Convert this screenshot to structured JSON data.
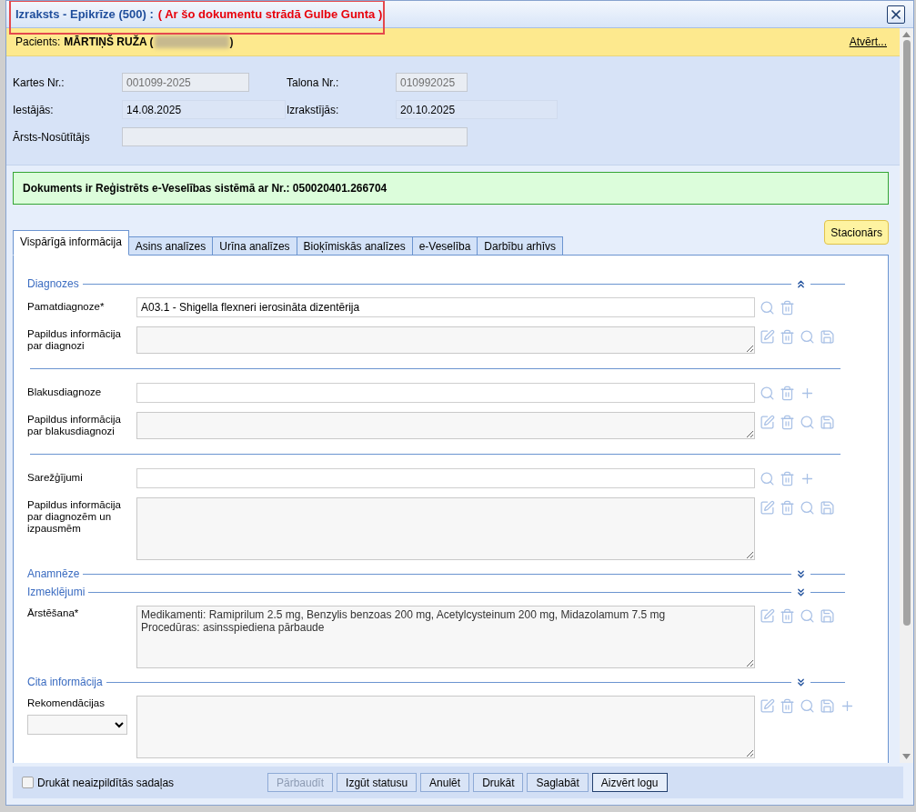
{
  "window": {
    "title": "Izraksts - Epikrīze (500) :",
    "lock_note": "( Ar šo dokumentu strādā Gulbe Gunta )",
    "highlighted": true
  },
  "patient": {
    "label": "Pacients:",
    "name": "MĀRTIŅŠ RUŽA (",
    "name_end": ")",
    "open_link": "Atvērt..."
  },
  "record_fields": [
    {
      "label": "Kartes Nr.:",
      "value": "001099-2025",
      "kind": "input",
      "disabled": true
    },
    {
      "label": "Talona Nr.:",
      "value": "010992025",
      "kind": "input",
      "disabled": true
    },
    {
      "label": "Iestājās:",
      "value": "14.08.2025",
      "kind": "text",
      "disabled": false
    },
    {
      "label": "Izrakstījās:",
      "value": "20.10.2025",
      "kind": "text",
      "disabled": false
    },
    {
      "label": "Ārsts-Nosūtītājs",
      "kind": "input",
      "disabled": true
    }
  ],
  "registration_notice": "Dokuments ir Reģistrēts e-Veselības sistēmā ar Nr.: 050020401.266704",
  "stationary_button": "Stacionārs",
  "tabs": [
    {
      "label": "Vispārīgā informācija",
      "selected": true
    },
    {
      "label": "Asins analīzes",
      "selected": false
    },
    {
      "label": "Urīna analīzes",
      "selected": false
    },
    {
      "label": "Bioķīmiskās analīzes",
      "selected": false
    },
    {
      "label": "e-Veselība",
      "selected": false
    },
    {
      "label": "Darbību arhīvs",
      "selected": false
    }
  ],
  "sections": [
    {
      "title": "Diagnozes",
      "expanded": true,
      "groups": [
        [
          {
            "label": "Pamatdiagnoze*",
            "kind": "input",
            "value": "A03.1 - Shigella flexneri ierosināta dizentērija",
            "can_add": false,
            "has_selector": false
          },
          {
            "label": "Papildus informācija par diagnozi",
            "kind": "note",
            "can_add": false,
            "has_selector": false
          }
        ],
        [
          {
            "label": "Blakusdiagnoze",
            "kind": "input",
            "can_add": true,
            "has_selector": false
          },
          {
            "label": "Papildus informācija par blakusdiagnozi",
            "kind": "note",
            "can_add": false,
            "has_selector": false
          }
        ],
        [
          {
            "label": "Sarežģījumi",
            "kind": "input",
            "can_add": true,
            "has_selector": false
          },
          {
            "label": "Papildus informācija par diagnozēm un izpausmēm",
            "kind": "long_note",
            "can_add": false,
            "has_selector": false
          }
        ]
      ]
    },
    {
      "title": "Anamnēze",
      "expanded": false
    },
    {
      "title": "Izmeklējumi",
      "expanded": false,
      "groups": [
        [
          {
            "label": "Ārstēšana*",
            "kind": "long_note",
            "value": "Medikamenti: Ramiprilum 2.5 mg, Benzylis benzoas 200 mg, Acetylcysteinum 200 mg, Midazolamum 7.5 mg\nProcedūras: asinsspiediena pārbaude",
            "can_add": false,
            "has_selector": false
          }
        ]
      ]
    },
    {
      "title": "Cita informācija",
      "expanded": false,
      "groups": [
        [
          {
            "label": "Rekomendācijas",
            "kind": "long_note",
            "can_add": true,
            "has_selector": true
          }
        ]
      ]
    }
  ],
  "footer": {
    "checkbox": {
      "label": "Drukāt neaizpildītās sadaļas",
      "checked": false
    },
    "buttons": [
      {
        "label": "Pārbaudīt",
        "disabled": true,
        "primary": false
      },
      {
        "label": "Izgūt statusu",
        "disabled": false,
        "primary": false
      },
      {
        "label": "Anulēt",
        "disabled": false,
        "primary": false
      },
      {
        "label": "Drukāt",
        "disabled": false,
        "primary": false
      },
      {
        "label": "Saglabāt",
        "disabled": false,
        "primary": false
      },
      {
        "label": "Aizvērt logu",
        "disabled": false,
        "primary": true
      }
    ]
  }
}
